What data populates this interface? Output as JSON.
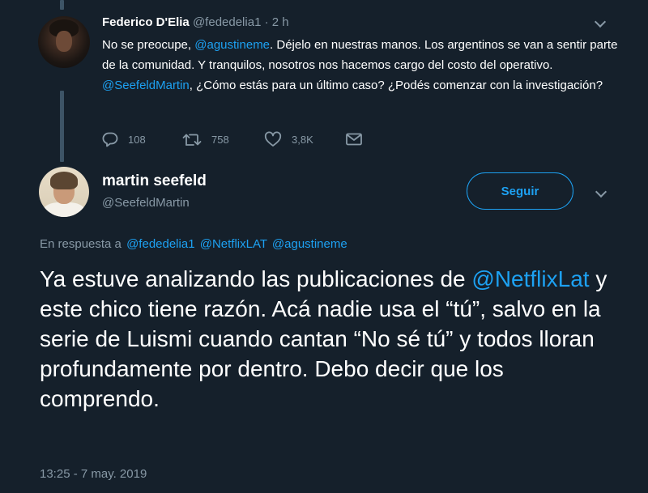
{
  "previous_tweet": {
    "author_name": "Federico D'Elia",
    "author_handle": "@fededelia1",
    "meta_separator": "·",
    "time_ago": "2 h",
    "text": {
      "part1": "No se preocupe, ",
      "mention1": "@agustineme",
      "part2": ". Déjelo en nuestras manos. Los argentinos se van a sentir parte de la comunidad. Y tranquilos, nosotros nos hacemos cargo del costo del operativo. ",
      "mention2": "@SeefeldMartin",
      "part3": ", ¿Cómo estás para un último caso? ¿Podés comenzar con la investigación?"
    },
    "actions": {
      "replies": "108",
      "retweets": "758",
      "likes": "3,8K"
    }
  },
  "main_tweet": {
    "author_name": "martin seefeld",
    "author_handle": "@SeefeldMartin",
    "follow_label": "Seguir",
    "reply_to": {
      "label": "En respuesta a",
      "mentions": [
        "@fededelia1",
        "@NetflixLAT",
        "@agustineme"
      ]
    },
    "text": {
      "part1": "Ya estuve analizando las publicaciones de ",
      "mention": "@NetflixLat",
      "part2": " y este chico tiene razón. Acá nadie usa el “tú”, salvo en la serie de Luismi cuando cantan “No sé tú” y todos lloran profundamente por dentro. Debo decir que los comprendo."
    },
    "timestamp": "13:25 - 7 may. 2019"
  },
  "icons": {
    "reply": "reply-bubble-icon",
    "retweet": "retweet-icon",
    "like": "heart-icon",
    "dm": "envelope-icon",
    "more": "chevron-down-icon"
  },
  "colors": {
    "background": "#15202b",
    "text": "#ffffff",
    "secondary": "#8899a6",
    "accent": "#1da1f2",
    "thread_line": "#3d5466"
  }
}
